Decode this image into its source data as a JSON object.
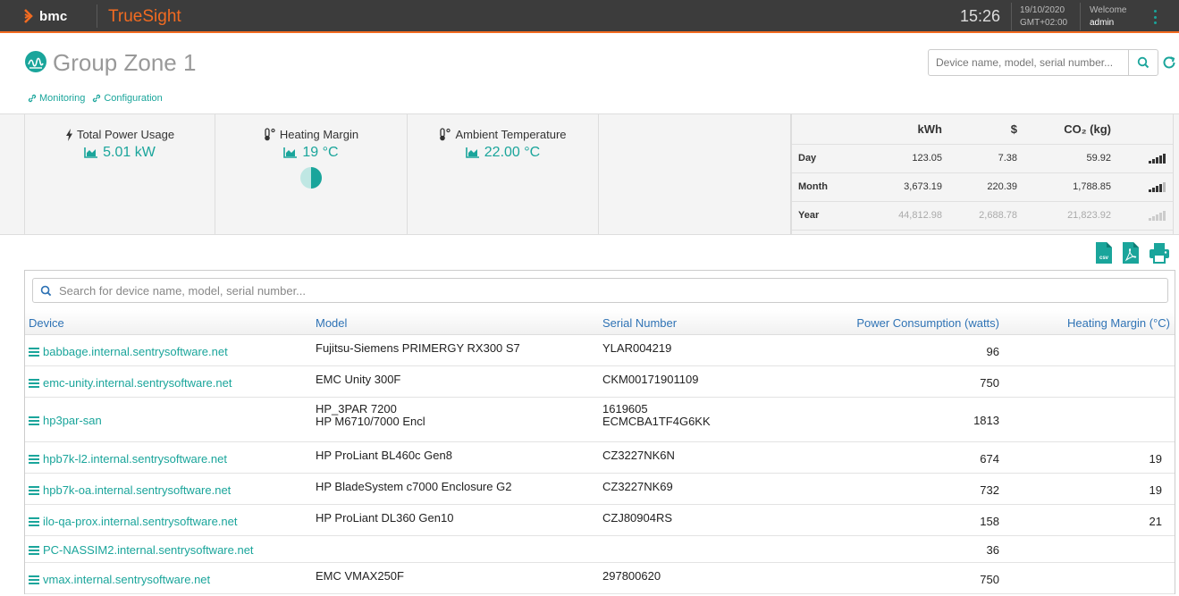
{
  "topbar": {
    "brand": "bmc",
    "product": "TrueSight",
    "time": "15:26",
    "date": "19/10/2020",
    "timezone": "GMT+02:00",
    "welcome": "Welcome",
    "user": "admin"
  },
  "header": {
    "title": "Group Zone 1",
    "links": [
      "Monitoring",
      "Configuration"
    ],
    "search_placeholder": "Device name, model, serial number..."
  },
  "summary": {
    "power": {
      "label": "Total Power Usage",
      "value": "5.01 kW"
    },
    "heating": {
      "label": "Heating Margin",
      "value": "19 °C",
      "pie_fraction": 0.5
    },
    "ambient": {
      "label": "Ambient Temperature",
      "value": "22.00 °C"
    }
  },
  "energy": {
    "headers": [
      "kWh",
      "$",
      "CO₂ (kg)"
    ],
    "rows": [
      {
        "label": "Day",
        "kwh": "123.05",
        "cost": "7.38",
        "co2": "59.92"
      },
      {
        "label": "Month",
        "kwh": "3,673.19",
        "cost": "220.39",
        "co2": "1,788.85"
      },
      {
        "label": "Year",
        "kwh": "44,812.98",
        "cost": "2,688.78",
        "co2": "21,823.92"
      }
    ]
  },
  "exports": {
    "csv": "csv",
    "pdf": "pdf-icon",
    "print": "print-icon"
  },
  "devices": {
    "search_placeholder": "Search for device name, model, serial number...",
    "columns": [
      "Device",
      "Model",
      "Serial Number",
      "Power Consumption (watts)",
      "Heating Margin (°C)"
    ],
    "rows": [
      {
        "device": "babbage.internal.sentrysoftware.net",
        "model": [
          "Fujitsu-Siemens PRIMERGY RX300 S7"
        ],
        "serial": [
          "YLAR004219"
        ],
        "power": "96",
        "heating": ""
      },
      {
        "device": "emc-unity.internal.sentrysoftware.net",
        "model": [
          "EMC Unity 300F"
        ],
        "serial": [
          "CKM00171901109"
        ],
        "power": "750",
        "heating": ""
      },
      {
        "device": "hp3par-san",
        "model": [
          "HP_3PAR 7200",
          "HP M6710/7000 Encl"
        ],
        "serial": [
          "1619605",
          "ECMCBA1TF4G6KK"
        ],
        "power": "1813",
        "heating": ""
      },
      {
        "device": "hpb7k-l2.internal.sentrysoftware.net",
        "model": [
          "HP ProLiant BL460c Gen8"
        ],
        "serial": [
          "CZ3227NK6N"
        ],
        "power": "674",
        "heating": "19"
      },
      {
        "device": "hpb7k-oa.internal.sentrysoftware.net",
        "model": [
          "HP BladeSystem c7000 Enclosure G2"
        ],
        "serial": [
          "CZ3227NK69"
        ],
        "power": "732",
        "heating": "19"
      },
      {
        "device": "ilo-qa-prox.internal.sentrysoftware.net",
        "model": [
          "HP ProLiant DL360 Gen10"
        ],
        "serial": [
          "CZJ80904RS"
        ],
        "power": "158",
        "heating": "21"
      },
      {
        "device": "PC-NASSIM2.internal.sentrysoftware.net",
        "model": [],
        "serial": [],
        "power": "36",
        "heating": ""
      },
      {
        "device": "vmax.internal.sentrysoftware.net",
        "model": [
          "EMC VMAX250F"
        ],
        "serial": [
          "297800620"
        ],
        "power": "750",
        "heating": ""
      }
    ]
  },
  "colors": {
    "accent": "#1aa59b",
    "brand": "#f26b21",
    "link": "#2f73b5",
    "topbar": "#3c3c3c"
  }
}
